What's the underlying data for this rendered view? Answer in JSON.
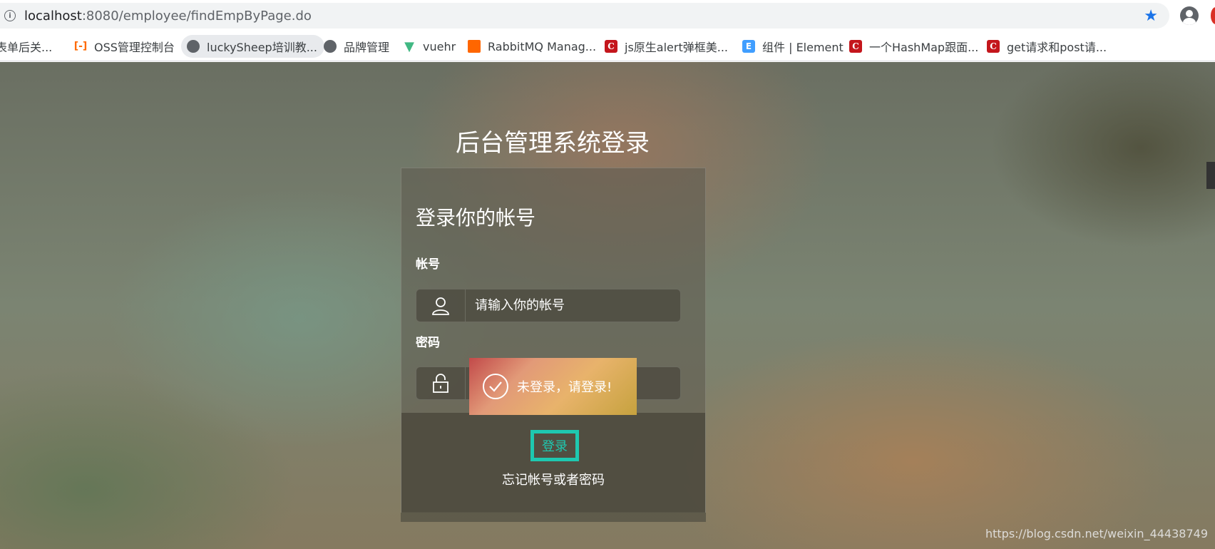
{
  "browser": {
    "url_host": "localhost",
    "url_path": ":8080/employee/findEmpByPage.do",
    "bookmarks": [
      {
        "label": "表单后关...",
        "icon": "none"
      },
      {
        "label": "OSS管理控制台",
        "icon": "oss-icon"
      },
      {
        "label": "luckySheep培训教...",
        "icon": "globe-icon"
      },
      {
        "label": "品牌管理",
        "icon": "globe-icon"
      },
      {
        "label": "vuehr",
        "icon": "vue-icon"
      },
      {
        "label": "RabbitMQ Manag...",
        "icon": "rabbitmq-icon"
      },
      {
        "label": "js原生alert弹框美...",
        "icon": "csdn-icon"
      },
      {
        "label": "组件 | Element",
        "icon": "element-icon"
      },
      {
        "label": "一个HashMap跟面...",
        "icon": "csdn-icon"
      },
      {
        "label": "get请求和post请...",
        "icon": "csdn-icon"
      }
    ]
  },
  "page": {
    "title": "后台管理系统登录",
    "panel_heading": "登录你的帐号",
    "account_label": "帐号",
    "account_placeholder": "请输入你的帐号",
    "password_label": "密码",
    "login_button": "登录",
    "forgot_link": "忘记帐号或者密码"
  },
  "toast": {
    "message": "未登录，请登录!"
  },
  "watermark": "https://blog.csdn.net/weixin_44438749",
  "colors": {
    "accent": "#1ec8b0",
    "toast_start": "#c24a4a",
    "toast_end": "#c6a23e"
  }
}
